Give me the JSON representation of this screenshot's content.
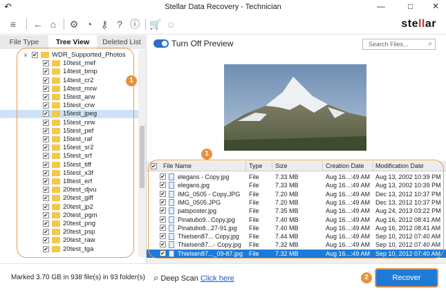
{
  "window": {
    "title": "Stellar Data Recovery - Technician"
  },
  "toolbar": {
    "icons": [
      "menu-icon",
      "back-arrow-icon",
      "home-icon",
      "settings-icon",
      "scan-file-icon",
      "key-icon",
      "help-icon",
      "info-icon",
      "cart-icon",
      "user-icon"
    ],
    "logo_prefix": "ste",
    "logo_mid": "ll",
    "logo_suffix": "ar"
  },
  "left": {
    "tabs": [
      "File Type",
      "Tree View",
      "Deleted List"
    ],
    "active_tab": "Tree View",
    "root": "WDR_Supported_Photos",
    "folders": [
      "10test_mef",
      "14test_bmp",
      "14test_cr2",
      "14test_mrw",
      "15test_arw",
      "15test_crw",
      "15test_jpeg",
      "15test_nrw",
      "15test_pef",
      "15test_raf",
      "15test_sr2",
      "15test_srf",
      "15test_tiff",
      "15test_x3f",
      "18test_erf",
      "20test_djvu",
      "20test_giff",
      "20test_jp2",
      "20test_pgm",
      "20test_png",
      "20test_psp",
      "20test_raw",
      "20test_tga"
    ],
    "selected": "15test_jpeg",
    "badge": "1"
  },
  "preview": {
    "toggle_label": "Turn Off Preview",
    "search_placeholder": "Search Files..."
  },
  "table": {
    "badge": "1",
    "columns": [
      "File Name",
      "Type",
      "Size",
      "Creation Date",
      "Modification Date"
    ],
    "rows": [
      [
        "elegans - Copy.jpg",
        "File",
        "7.33 MB",
        "Aug 16...:49 AM",
        "Aug 13, 2002 10:39 PM"
      ],
      [
        "elegans.jpg",
        "File",
        "7.33 MB",
        "Aug 16...:49 AM",
        "Aug 13, 2002 10:39 PM"
      ],
      [
        "IMG_0505 - Copy.JPG",
        "File",
        "7.20 MB",
        "Aug 16...:49 AM",
        "Dec 13, 2012 10:37 PM"
      ],
      [
        "IMG_0505.JPG",
        "File",
        "7.20 MB",
        "Aug 16...:49 AM",
        "Dec 13, 2012 10:37 PM"
      ],
      [
        "patsposter.jpg",
        "File",
        "7.35 MB",
        "Aug 16...:49 AM",
        "Aug 24, 2013 03:22 PM"
      ],
      [
        "Pinatubo9...Copy.jpg",
        "File",
        "7.40 MB",
        "Aug 16...:49 AM",
        "Aug 16, 2012 08:41 AM"
      ],
      [
        "Pinatubo8...27-91.jpg",
        "File",
        "7.40 MB",
        "Aug 16...:49 AM",
        "Aug 16, 2012 08:41 AM"
      ],
      [
        "Thielsen87... Copy.jpg",
        "File",
        "7.44 MB",
        "Aug 16...:49 AM",
        "Sep 10, 2012 07:40 AM"
      ],
      [
        "Thielsen87...- Copy.jpg",
        "File",
        "7.32 MB",
        "Aug 16...:49 AM",
        "Sep 10, 2012 07:40 AM"
      ],
      [
        "Thielsen87..._09-87.jpg",
        "File",
        "7.32 MB",
        "Aug 16...:49 AM",
        "Sep 10, 2012 07:40 AM"
      ]
    ],
    "selected_row": 9
  },
  "status": {
    "marked": "Marked 3.70 GB in 938 file(s) in 93 folder(s)",
    "deep_scan": "Deep Scan",
    "deep_scan_link": "Click here",
    "recover_label": "Recover",
    "recover_badge": "2"
  },
  "colors": {
    "accent": "#1e7ad8",
    "callout": "#e89141",
    "folder": "#f3c94c"
  }
}
